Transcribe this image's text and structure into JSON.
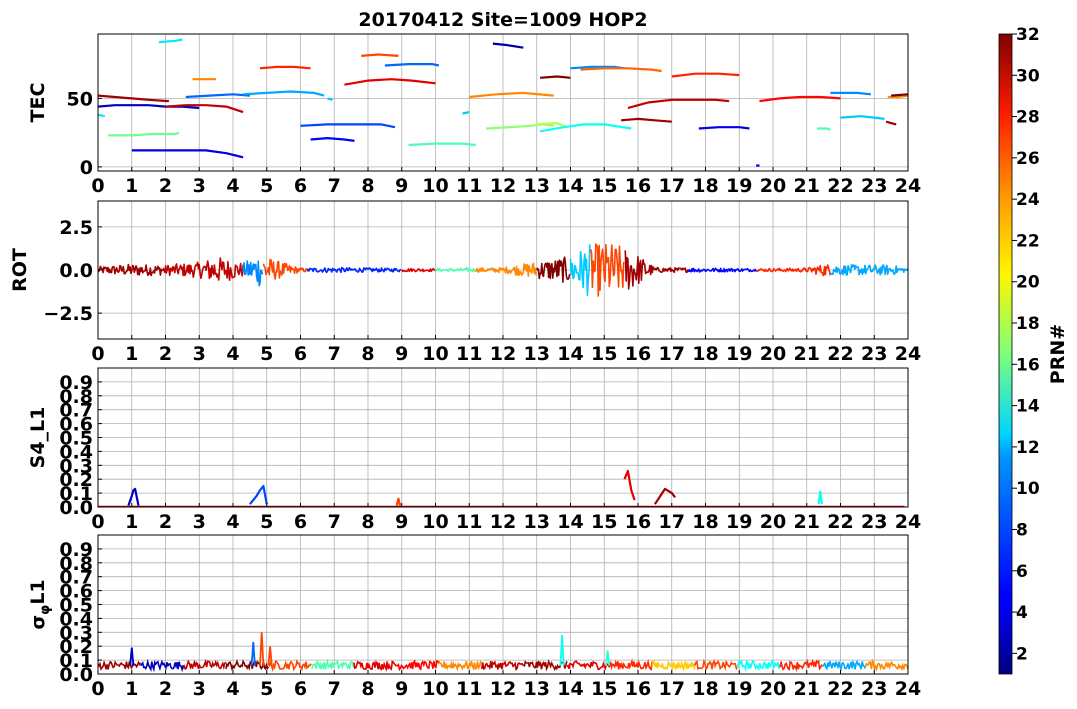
{
  "title": "20170412 Site=1009 HOP2",
  "colorbar": {
    "label": "PRN#",
    "min": 1,
    "max": 32,
    "ticks": [
      "2",
      "4",
      "6",
      "8",
      "10",
      "12",
      "14",
      "16",
      "18",
      "20",
      "22",
      "24",
      "26",
      "28",
      "30",
      "32"
    ],
    "colormap": "jet"
  },
  "chart_data": [
    {
      "type": "line",
      "ylabel": "TEC",
      "xlabel": "",
      "xlim": [
        0,
        24
      ],
      "ylim": [
        -3,
        97
      ],
      "yticks": [
        "0",
        "50"
      ],
      "xticks": [
        "0",
        "1",
        "2",
        "3",
        "4",
        "5",
        "6",
        "7",
        "8",
        "9",
        "10",
        "11",
        "12",
        "13",
        "14",
        "15",
        "16",
        "17",
        "18",
        "19",
        "20",
        "21",
        "22",
        "23",
        "24"
      ],
      "grid": true,
      "series": [
        {
          "prn": 31,
          "x": [
            0.0,
            0.5,
            1.0,
            1.5,
            2.1
          ],
          "y": [
            52,
            51,
            50,
            49,
            48
          ]
        },
        {
          "prn": 3,
          "x": [
            0.0,
            0.5,
            1.0,
            1.5,
            2.0,
            2.5,
            3.0
          ],
          "y": [
            44,
            45,
            45,
            45,
            44,
            44,
            43
          ]
        },
        {
          "prn": 12,
          "x": [
            0.0,
            0.2
          ],
          "y": [
            38,
            37
          ]
        },
        {
          "prn": 16,
          "x": [
            0.3,
            1.0,
            1.6,
            2.3,
            2.4
          ],
          "y": [
            23,
            23,
            24,
            24,
            25
          ]
        },
        {
          "prn": 4,
          "x": [
            1.0,
            1.8,
            2.5,
            3.2,
            3.8,
            4.3
          ],
          "y": [
            12,
            12,
            12,
            12,
            10,
            7
          ]
        },
        {
          "prn": 12,
          "x": [
            1.8,
            2.3,
            2.5
          ],
          "y": [
            91,
            92,
            93
          ]
        },
        {
          "prn": 30,
          "x": [
            2.0,
            2.6,
            3.2,
            3.8,
            4.3
          ],
          "y": [
            44,
            45,
            45,
            44,
            40
          ]
        },
        {
          "prn": 24,
          "x": [
            2.8,
            3.2,
            3.5
          ],
          "y": [
            64,
            64,
            64
          ]
        },
        {
          "prn": 8,
          "x": [
            2.6,
            3.3,
            4.0,
            4.5
          ],
          "y": [
            51,
            52,
            53,
            52
          ]
        },
        {
          "prn": 27,
          "x": [
            4.8,
            5.3,
            5.8,
            6.3
          ],
          "y": [
            72,
            73,
            73,
            72
          ]
        },
        {
          "prn": 10,
          "x": [
            4.3,
            5.0,
            5.7,
            6.4,
            6.7
          ],
          "y": [
            53,
            54,
            55,
            54,
            52
          ]
        },
        {
          "prn": 11,
          "x": [
            6.8,
            6.95
          ],
          "y": [
            50,
            49
          ]
        },
        {
          "prn": 7,
          "x": [
            6.0,
            6.8,
            7.6,
            8.4,
            8.8
          ],
          "y": [
            30,
            31,
            31,
            31,
            29
          ]
        },
        {
          "prn": 5,
          "x": [
            6.3,
            6.8,
            7.3,
            7.6
          ],
          "y": [
            20,
            21,
            20,
            19
          ]
        },
        {
          "prn": 29,
          "x": [
            7.3,
            8.0,
            8.7,
            9.3,
            10.0
          ],
          "y": [
            60,
            63,
            64,
            63,
            61
          ]
        },
        {
          "prn": 26,
          "x": [
            7.8,
            8.3,
            8.9
          ],
          "y": [
            81,
            82,
            81
          ]
        },
        {
          "prn": 8,
          "x": [
            8.5,
            9.2,
            9.9,
            10.1
          ],
          "y": [
            74,
            75,
            75,
            74
          ]
        },
        {
          "prn": 15,
          "x": [
            9.2,
            10.0,
            10.8,
            11.2
          ],
          "y": [
            16,
            17,
            17,
            16
          ]
        },
        {
          "prn": 11,
          "x": [
            10.8,
            11.0
          ],
          "y": [
            39,
            40
          ]
        },
        {
          "prn": 2,
          "x": [
            11.7,
            12.1,
            12.6
          ],
          "y": [
            90,
            89,
            87
          ]
        },
        {
          "prn": 24,
          "x": [
            11.0,
            11.8,
            12.6,
            13.5
          ],
          "y": [
            51,
            53,
            54,
            52
          ]
        },
        {
          "prn": 17,
          "x": [
            11.5,
            12.2,
            12.8,
            13.2,
            13.5
          ],
          "y": [
            28,
            29,
            30,
            31,
            30
          ]
        },
        {
          "prn": 18,
          "x": [
            13.0,
            13.6,
            13.9
          ],
          "y": [
            31,
            32,
            29
          ]
        },
        {
          "prn": 32,
          "x": [
            13.1,
            13.6,
            14.0
          ],
          "y": [
            65,
            66,
            65
          ]
        },
        {
          "prn": 13,
          "x": [
            13.1,
            13.8,
            14.4,
            15.0,
            15.8
          ],
          "y": [
            26,
            29,
            31,
            31,
            28
          ]
        },
        {
          "prn": 9,
          "x": [
            14.0,
            14.6,
            15.3,
            15.6
          ],
          "y": [
            72,
            73,
            73,
            72
          ]
        },
        {
          "prn": 25,
          "x": [
            14.3,
            15.0,
            15.7,
            16.4,
            16.7
          ],
          "y": [
            71,
            72,
            72,
            71,
            70
          ]
        },
        {
          "prn": 30,
          "x": [
            15.7,
            16.3,
            17.0,
            17.6,
            18.3,
            18.7
          ],
          "y": [
            43,
            47,
            49,
            49,
            49,
            48
          ]
        },
        {
          "prn": 31,
          "x": [
            15.5,
            16.0,
            16.5,
            17.0
          ],
          "y": [
            34,
            35,
            34,
            33
          ]
        },
        {
          "prn": 27,
          "x": [
            17.0,
            17.7,
            18.4,
            19.0
          ],
          "y": [
            66,
            68,
            68,
            67
          ]
        },
        {
          "prn": 4,
          "x": [
            17.8,
            18.4,
            19.0,
            19.3
          ],
          "y": [
            28,
            29,
            29,
            28
          ]
        },
        {
          "prn": 5,
          "x": [
            19.5,
            19.6
          ],
          "y": [
            1,
            1
          ]
        },
        {
          "prn": 28,
          "x": [
            19.6,
            20.2,
            20.8,
            21.4,
            22.0
          ],
          "y": [
            48,
            50,
            51,
            51,
            50
          ]
        },
        {
          "prn": 15,
          "x": [
            21.3,
            21.6,
            21.7
          ],
          "y": [
            28,
            28,
            27
          ]
        },
        {
          "prn": 9,
          "x": [
            21.7,
            22.1,
            22.5,
            22.9
          ],
          "y": [
            54,
            54,
            54,
            53
          ]
        },
        {
          "prn": 11,
          "x": [
            22.0,
            22.6,
            23.0,
            23.3
          ],
          "y": [
            36,
            37,
            36,
            35
          ]
        },
        {
          "prn": 31,
          "x": [
            23.35,
            23.5,
            23.65
          ],
          "y": [
            33,
            32,
            31
          ]
        },
        {
          "prn": 24,
          "x": [
            23.4,
            23.7,
            24.0
          ],
          "y": [
            51,
            51,
            52
          ]
        },
        {
          "prn": 32,
          "x": [
            23.5,
            24.0
          ],
          "y": [
            52,
            53
          ]
        }
      ]
    },
    {
      "type": "line",
      "ylabel": "ROT",
      "xlabel": "",
      "xlim": [
        0,
        24
      ],
      "ylim": [
        -4,
        4
      ],
      "yticks": [
        "−2.5",
        "0.0",
        "2.5"
      ],
      "xticks": [
        "0",
        "1",
        "2",
        "3",
        "4",
        "5",
        "6",
        "7",
        "8",
        "9",
        "10",
        "11",
        "12",
        "13",
        "14",
        "15",
        "16",
        "17",
        "18",
        "19",
        "20",
        "21",
        "22",
        "23",
        "24"
      ],
      "grid": true,
      "noise_envelope": [
        {
          "x": 0,
          "amp": 0.2
        },
        {
          "x": 1,
          "amp": 0.35
        },
        {
          "x": 2,
          "amp": 0.3
        },
        {
          "x": 3,
          "amp": 0.45
        },
        {
          "x": 3.5,
          "amp": 0.8
        },
        {
          "x": 4.3,
          "amp": 0.4
        },
        {
          "x": 4.8,
          "amp": 1.0
        },
        {
          "x": 5.2,
          "amp": 0.6
        },
        {
          "x": 6,
          "amp": 0.12
        },
        {
          "x": 7,
          "amp": 0.15
        },
        {
          "x": 9,
          "amp": 0.1
        },
        {
          "x": 10,
          "amp": 0.08
        },
        {
          "x": 12,
          "amp": 0.15
        },
        {
          "x": 13,
          "amp": 0.5
        },
        {
          "x": 14,
          "amp": 0.8
        },
        {
          "x": 14.5,
          "amp": 1.5
        },
        {
          "x": 15.2,
          "amp": 1.6
        },
        {
          "x": 15.8,
          "amp": 1.2
        },
        {
          "x": 16.5,
          "amp": 0.15
        },
        {
          "x": 18,
          "amp": 0.12
        },
        {
          "x": 19.5,
          "amp": 0.08
        },
        {
          "x": 21,
          "amp": 0.12
        },
        {
          "x": 21.5,
          "amp": 0.35
        },
        {
          "x": 22,
          "amp": 0.3
        },
        {
          "x": 23.5,
          "amp": 0.3
        },
        {
          "x": 24,
          "amp": 0.1
        }
      ],
      "active_prns": [
        {
          "x0": 0,
          "x1": 2,
          "prn": 31
        },
        {
          "x0": 2,
          "x1": 4.3,
          "prn": 30
        },
        {
          "x0": 4.3,
          "x1": 4.9,
          "prn": 9
        },
        {
          "x0": 4.9,
          "x1": 6.2,
          "prn": 26
        },
        {
          "x0": 6.2,
          "x1": 9,
          "prn": 6
        },
        {
          "x0": 9,
          "x1": 10,
          "prn": 29
        },
        {
          "x0": 10,
          "x1": 11.2,
          "prn": 15
        },
        {
          "x0": 11.2,
          "x1": 13,
          "prn": 24
        },
        {
          "x0": 13,
          "x1": 14,
          "prn": 32
        },
        {
          "x0": 14,
          "x1": 14.6,
          "prn": 11
        },
        {
          "x0": 14.6,
          "x1": 15.6,
          "prn": 26
        },
        {
          "x0": 15.6,
          "x1": 17.5,
          "prn": 31
        },
        {
          "x0": 17.5,
          "x1": 19.5,
          "prn": 5
        },
        {
          "x0": 19.5,
          "x1": 21.7,
          "prn": 27
        },
        {
          "x0": 21.7,
          "x1": 24,
          "prn": 10
        }
      ]
    },
    {
      "type": "line",
      "ylabel": "S4_L1",
      "xlabel": "",
      "xlim": [
        0,
        24
      ],
      "ylim": [
        0,
        1
      ],
      "yticks": [
        "0.0",
        "0.1",
        "0.2",
        "0.3",
        "0.4",
        "0.5",
        "0.6",
        "0.7",
        "0.8",
        "0.9"
      ],
      "xticks": [
        "0",
        "1",
        "2",
        "3",
        "4",
        "5",
        "6",
        "7",
        "8",
        "9",
        "10",
        "11",
        "12",
        "13",
        "14",
        "15",
        "16",
        "17",
        "18",
        "19",
        "20",
        "21",
        "22",
        "23",
        "24"
      ],
      "grid": true,
      "series": [
        {
          "prn": 3,
          "x": [
            0.9,
            1.0,
            1.05,
            1.1,
            1.15,
            1.2
          ],
          "y": [
            0.01,
            0.08,
            0.12,
            0.13,
            0.07,
            0.01
          ]
        },
        {
          "prn": 7,
          "x": [
            4.5,
            4.7,
            4.8,
            4.9,
            5.0
          ],
          "y": [
            0.02,
            0.08,
            0.12,
            0.15,
            0.02
          ]
        },
        {
          "prn": 26,
          "x": [
            8.85,
            8.9,
            8.95
          ],
          "y": [
            0.01,
            0.06,
            0.01
          ]
        },
        {
          "prn": 29,
          "x": [
            15.6,
            15.7,
            15.8,
            15.9
          ],
          "y": [
            0.2,
            0.26,
            0.12,
            0.05
          ]
        },
        {
          "prn": 31,
          "x": [
            16.5,
            16.8,
            17.0,
            17.1
          ],
          "y": [
            0.02,
            0.13,
            0.1,
            0.07
          ]
        },
        {
          "prn": 13,
          "x": [
            21.35,
            21.4,
            21.45
          ],
          "y": [
            0.02,
            0.11,
            0.02
          ]
        }
      ]
    },
    {
      "type": "line",
      "ylabel": "σ_φL1",
      "xlabel": "",
      "xlim": [
        0,
        24
      ],
      "ylim": [
        0,
        1
      ],
      "yticks": [
        "0.0",
        "0.1",
        "0.2",
        "0.3",
        "0.4",
        "0.5",
        "0.6",
        "0.7",
        "0.8",
        "0.9"
      ],
      "xticks": [
        "0",
        "1",
        "2",
        "3",
        "4",
        "5",
        "6",
        "7",
        "8",
        "9",
        "10",
        "11",
        "12",
        "13",
        "14",
        "15",
        "16",
        "17",
        "18",
        "19",
        "20",
        "21",
        "22",
        "23",
        "24"
      ],
      "grid": true,
      "baseline": 0.06,
      "spikes": [
        {
          "x": 1.0,
          "y": 0.19,
          "prn": 3
        },
        {
          "x": 4.6,
          "y": 0.23,
          "prn": 8
        },
        {
          "x": 4.85,
          "y": 0.3,
          "prn": 26
        },
        {
          "x": 5.1,
          "y": 0.2,
          "prn": 26
        },
        {
          "x": 13.75,
          "y": 0.28,
          "prn": 13
        },
        {
          "x": 15.1,
          "y": 0.17,
          "prn": 14
        }
      ]
    }
  ]
}
